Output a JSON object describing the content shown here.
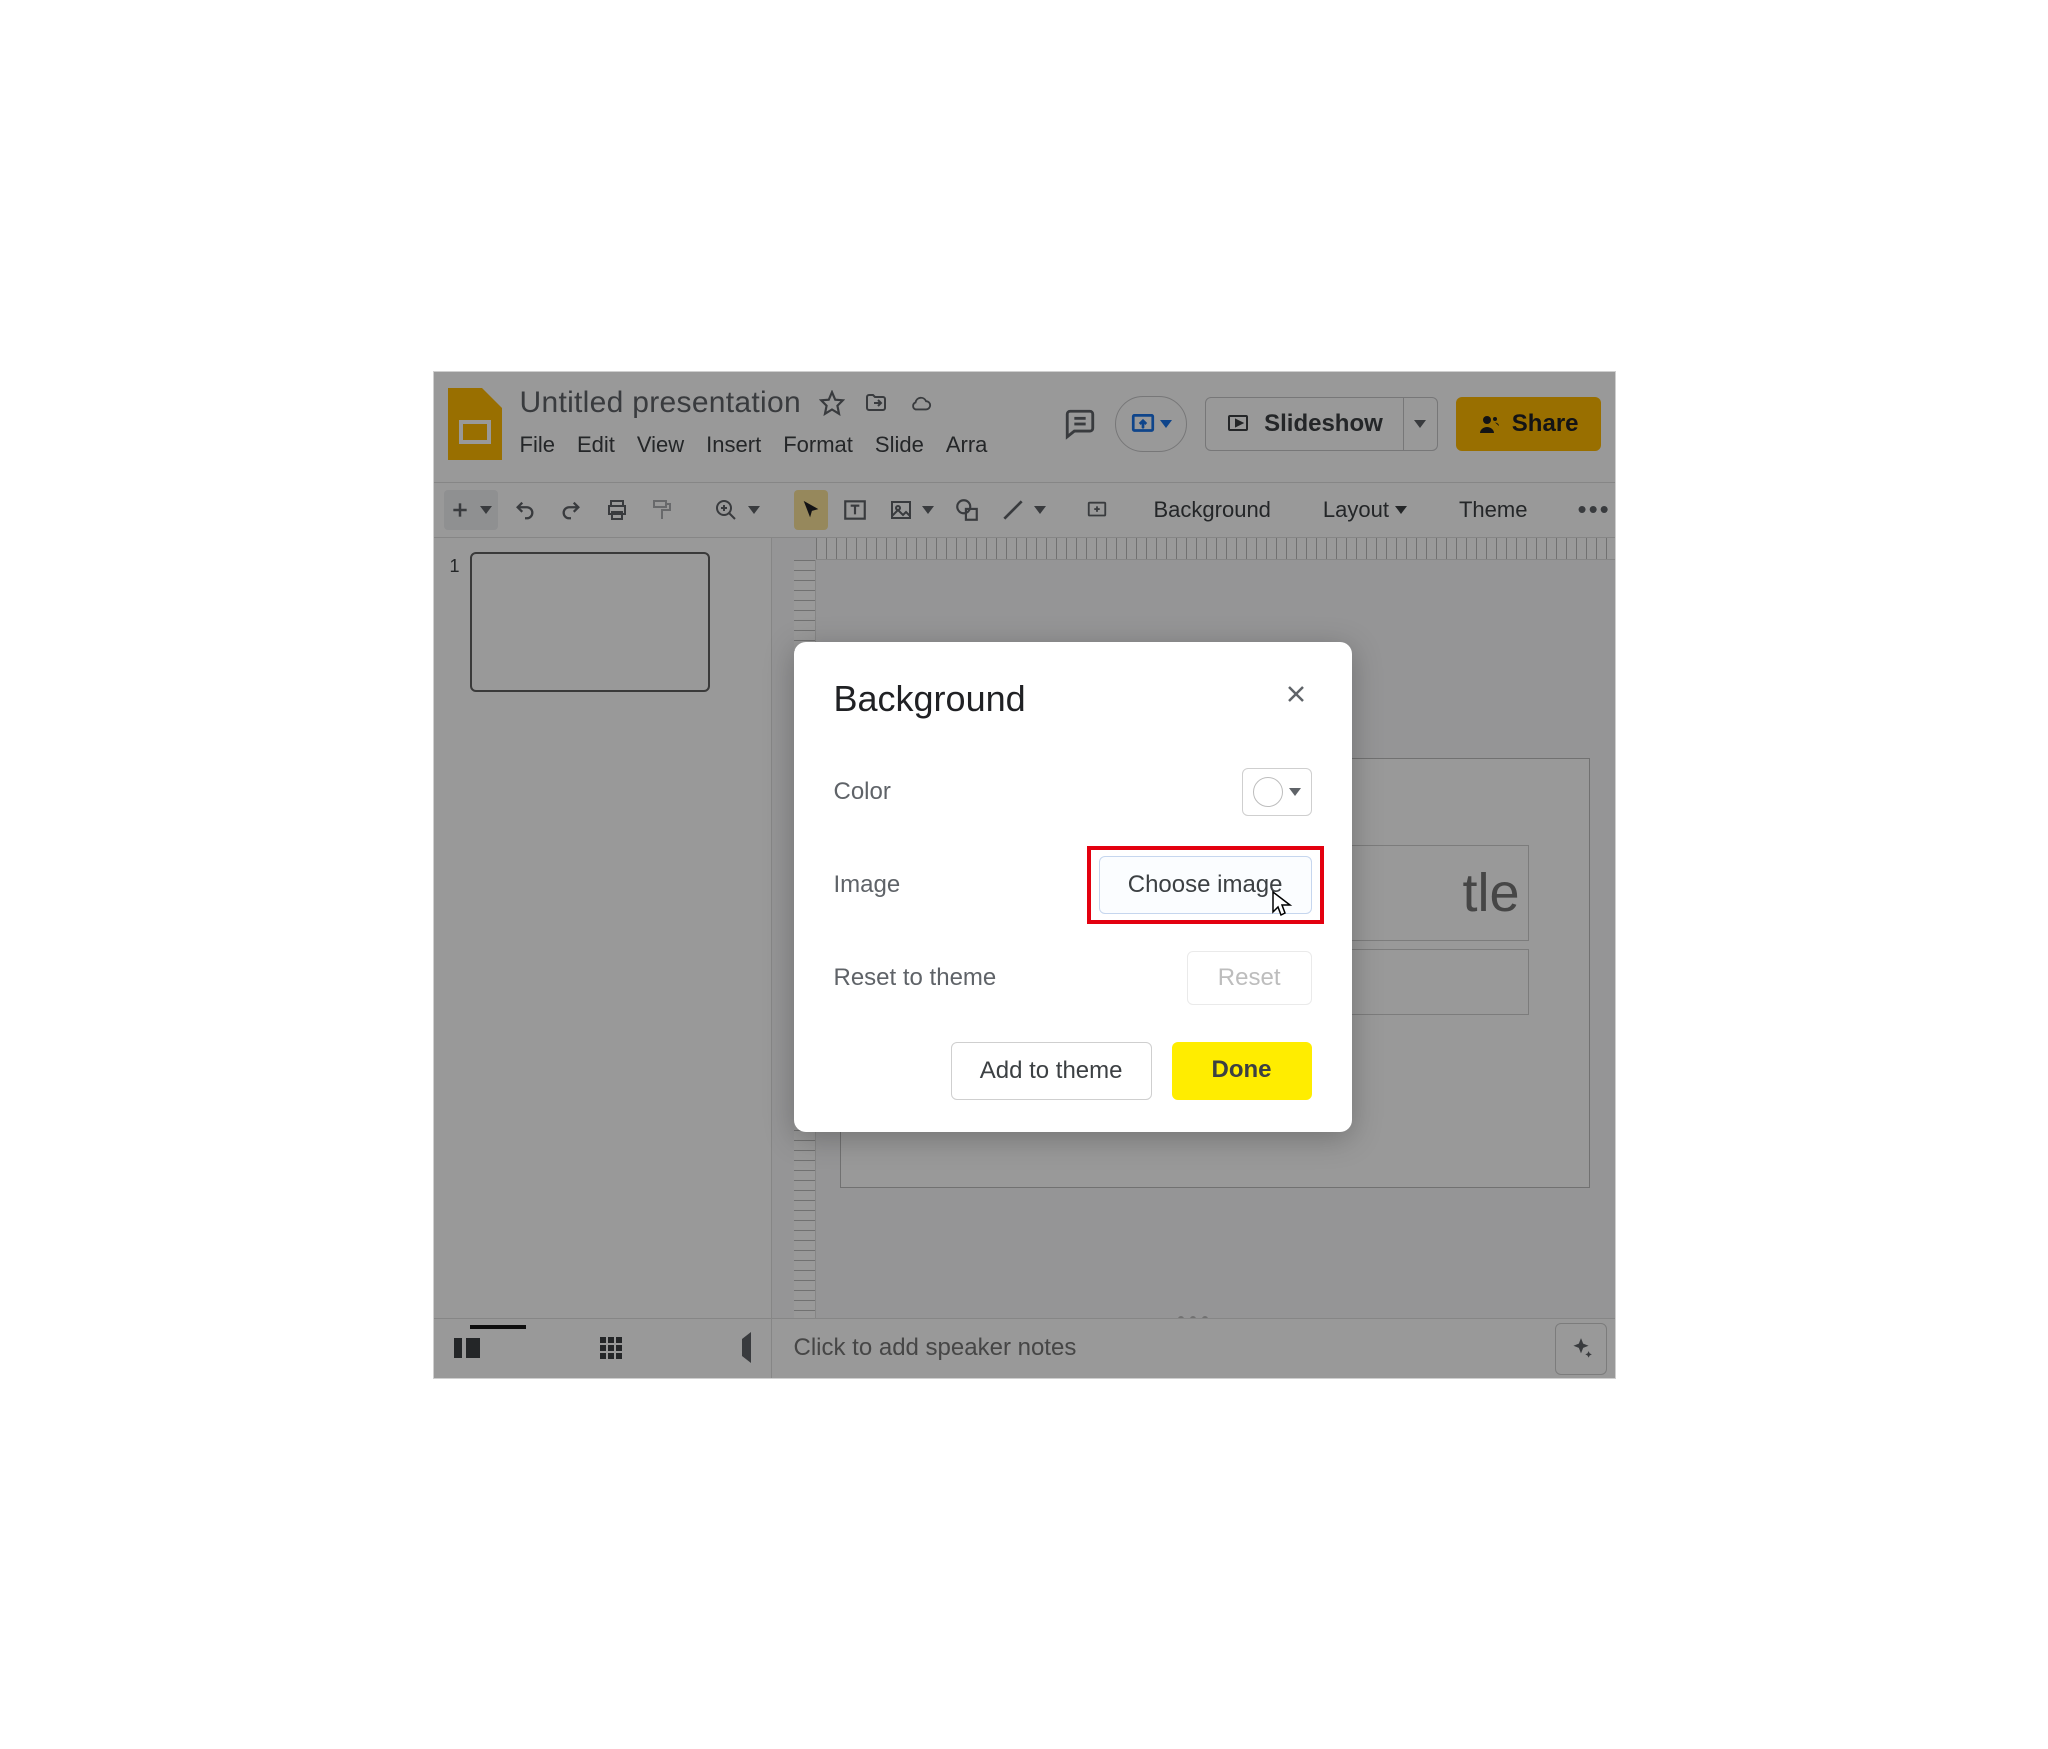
{
  "doc": {
    "title": "Untitled presentation"
  },
  "menus": [
    "File",
    "Edit",
    "View",
    "Insert",
    "Format",
    "Slide",
    "Arra"
  ],
  "header": {
    "slideshow": "Slideshow",
    "share": "Share"
  },
  "toolbar": {
    "background": "Background",
    "layout": "Layout",
    "theme": "Theme"
  },
  "thumbnails": [
    {
      "number": "1"
    }
  ],
  "slide": {
    "title_tail": "tle"
  },
  "notes": {
    "placeholder": "Click to add speaker notes"
  },
  "dialog": {
    "title": "Background",
    "rows": {
      "color": "Color",
      "image": "Image",
      "reset_theme": "Reset to theme"
    },
    "buttons": {
      "choose_image": "Choose image",
      "reset": "Reset",
      "add_to_theme": "Add to theme",
      "done": "Done"
    }
  }
}
